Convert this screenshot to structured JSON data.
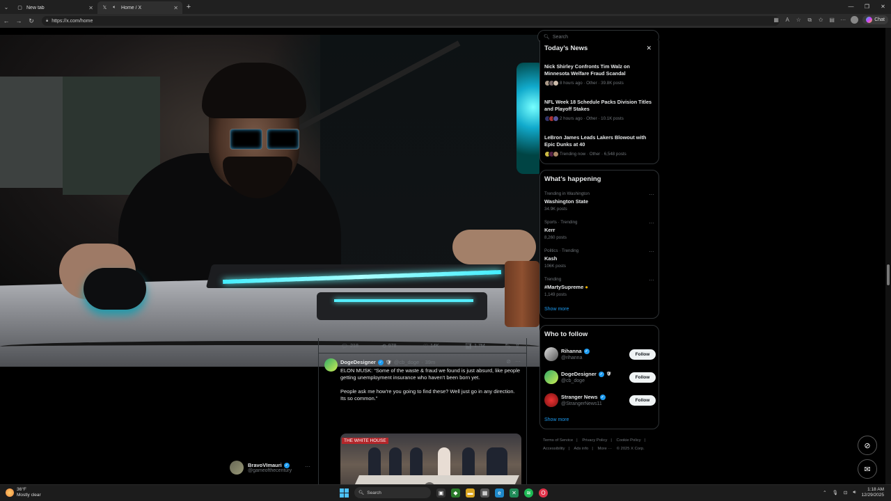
{
  "browser": {
    "tabs": [
      {
        "title": "New tab",
        "active": false,
        "icon": "new-tab-icon"
      },
      {
        "title": "Home / X",
        "active": true,
        "icon": "x-logo-icon"
      }
    ],
    "url": "https://x.com/home",
    "chat_label": "Chat"
  },
  "tweet_actions": {
    "replies": "218",
    "reposts": "978",
    "likes": "14K",
    "views": "1.7M"
  },
  "tweet": {
    "author": "DogeDesigner",
    "handle": "@cb_doge",
    "time": "39m",
    "text1": "ELON MUSK: “Some of the waste & fraud we found is just absurd, like people getting unemployment insurance who haven't been born yet.",
    "text2": "People ask me how're you going to find these? Well just go in any direction. Its so common.”",
    "media_banner": "THE WHITE HOUSE"
  },
  "left_user": {
    "name": "BravoVImauri",
    "handle": "@gameofthecentury"
  },
  "search": {
    "placeholder": "Search"
  },
  "news": {
    "title": "Today’s News",
    "items": [
      {
        "headline": "Nick Shirley Confronts Tim Walz on Minnesota Welfare Fraud Scandal",
        "meta": "8 hours ago · Other · 39.8K posts"
      },
      {
        "headline": "NFL Week 18 Schedule Packs Division Titles and Playoff Stakes",
        "meta": "2 hours ago · Other · 10.1K posts"
      },
      {
        "headline": "LeBron James Leads Lakers Blowout with Epic Dunks at 40",
        "meta": "Trending now · Other · 6,548 posts"
      }
    ]
  },
  "happening": {
    "title": "What’s happening",
    "trends": [
      {
        "context": "Trending in Washington",
        "topic": "Washington State",
        "count": "34.9K posts"
      },
      {
        "context": "Sports · Trending",
        "topic": "Kerr",
        "count": "8,260 posts"
      },
      {
        "context": "Politics · Trending",
        "topic": "Kash",
        "count": "106K posts"
      },
      {
        "context": "Trending",
        "topic": "#MartySupreme",
        "count": "1,149 posts"
      }
    ],
    "show_more": "Show more"
  },
  "who_to_follow": {
    "title": "Who to follow",
    "users": [
      {
        "name": "Rihanna",
        "handle": "@rihanna",
        "button": "Follow"
      },
      {
        "name": "DogeDesigner",
        "handle": "@cb_doge",
        "button": "Follow"
      },
      {
        "name": "Stranger News",
        "handle": "@StrangerNews11",
        "button": "Follow"
      }
    ],
    "show_more": "Show more"
  },
  "footer": {
    "links": [
      "Terms of Service",
      "Privacy Policy",
      "Cookie Policy",
      "Accessibility",
      "Ads info",
      "More ···"
    ],
    "copyright": "© 2025 X Corp."
  },
  "taskbar": {
    "temp": "36°F",
    "condition": "Mostly clear",
    "search_placeholder": "Search",
    "time": "1:18 AM",
    "date": "12/29/2025"
  },
  "colors": {
    "accent": "#1d9bf0",
    "verified": "#1d9bf0",
    "background": "#000000"
  }
}
